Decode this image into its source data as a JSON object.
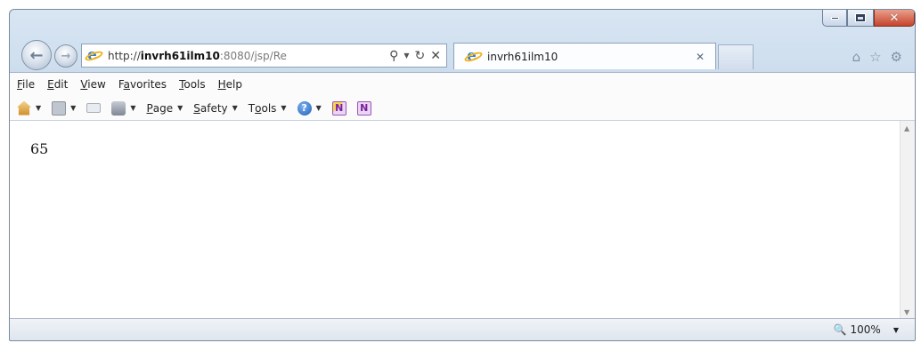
{
  "window": {
    "caption_buttons": [
      "minimize-icon",
      "maximize-icon",
      "close-icon"
    ],
    "close_glyph": "✕"
  },
  "nav": {
    "back_glyph": "←",
    "forward_glyph": "→",
    "address": {
      "scheme": "http://",
      "host": "invrh61ilm10",
      "rest": ":8080/jsp/Re",
      "search_glyph": "⚲",
      "dropdown_glyph": "▼",
      "refresh_glyph": "↻",
      "stop_glyph": "✕"
    },
    "tab": {
      "title": "invrh61ilm10",
      "close_glyph": "✕"
    },
    "right_icons": {
      "home": "⌂",
      "favorites": "☆",
      "tools": "⚙"
    }
  },
  "menubar": {
    "file": {
      "first": "F",
      "rest": "ile"
    },
    "edit": {
      "first": "E",
      "rest": "dit"
    },
    "view": {
      "first": "V",
      "rest": "iew"
    },
    "favorites": {
      "pre": "F",
      "u": "a",
      "rest": "vorites"
    },
    "tools": {
      "first": "T",
      "rest": "ools"
    },
    "help": {
      "first": "H",
      "rest": "elp"
    }
  },
  "commandbar": {
    "dropdown_glyph": "▼",
    "page": {
      "first": "P",
      "rest": "age"
    },
    "safety": {
      "first": "S",
      "rest": "afety"
    },
    "tools": {
      "pre": "T",
      "u": "o",
      "rest": "ols"
    },
    "help_glyph": "?",
    "onenote_glyph": "N"
  },
  "content": {
    "text": "65",
    "scroll_up": "▲",
    "scroll_down": "▼"
  },
  "statusbar": {
    "zoom_icon": "🔍",
    "zoom": "100%",
    "zoom_dropdown": "▼"
  }
}
